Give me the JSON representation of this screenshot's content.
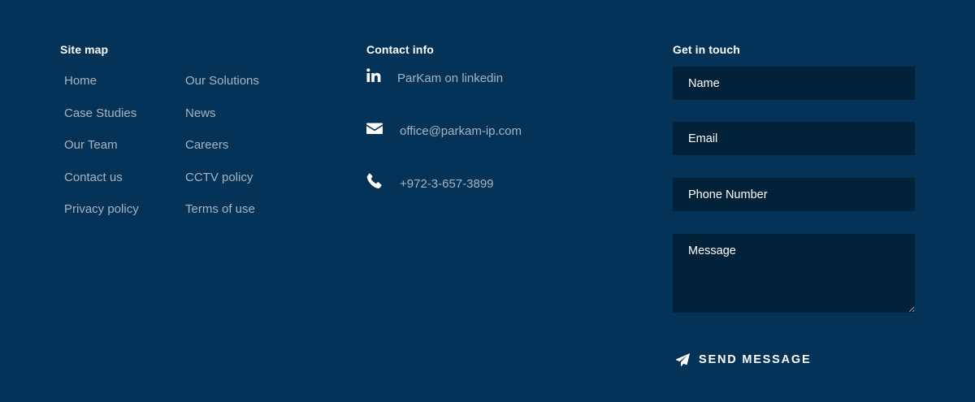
{
  "sitemap": {
    "title": "Site map",
    "col1": [
      "Home",
      "Case Studies",
      "Our Team",
      "Contact us",
      "Privacy policy"
    ],
    "col2": [
      "Our Solutions",
      "News",
      "Careers",
      "CCTV policy",
      "Terms of use"
    ]
  },
  "contact": {
    "title": "Contact info",
    "items": [
      {
        "icon": "linkedin-icon",
        "text": "ParKam on linkedin"
      },
      {
        "icon": "envelope-icon",
        "text": "office@parkam-ip.com"
      },
      {
        "icon": "phone-icon",
        "text": "+972-3-657-3899"
      }
    ]
  },
  "form": {
    "title": "Get in touch",
    "name_placeholder": "Name",
    "email_placeholder": "Email",
    "phone_placeholder": "Phone Number",
    "message_placeholder": "Message",
    "send_label": "Send message",
    "send_icon": "paper-plane-icon"
  },
  "colors": {
    "background": "#053357",
    "field_background": "#02223a",
    "link_text": "#a7b4c2",
    "heading_text": "#ffffff"
  }
}
